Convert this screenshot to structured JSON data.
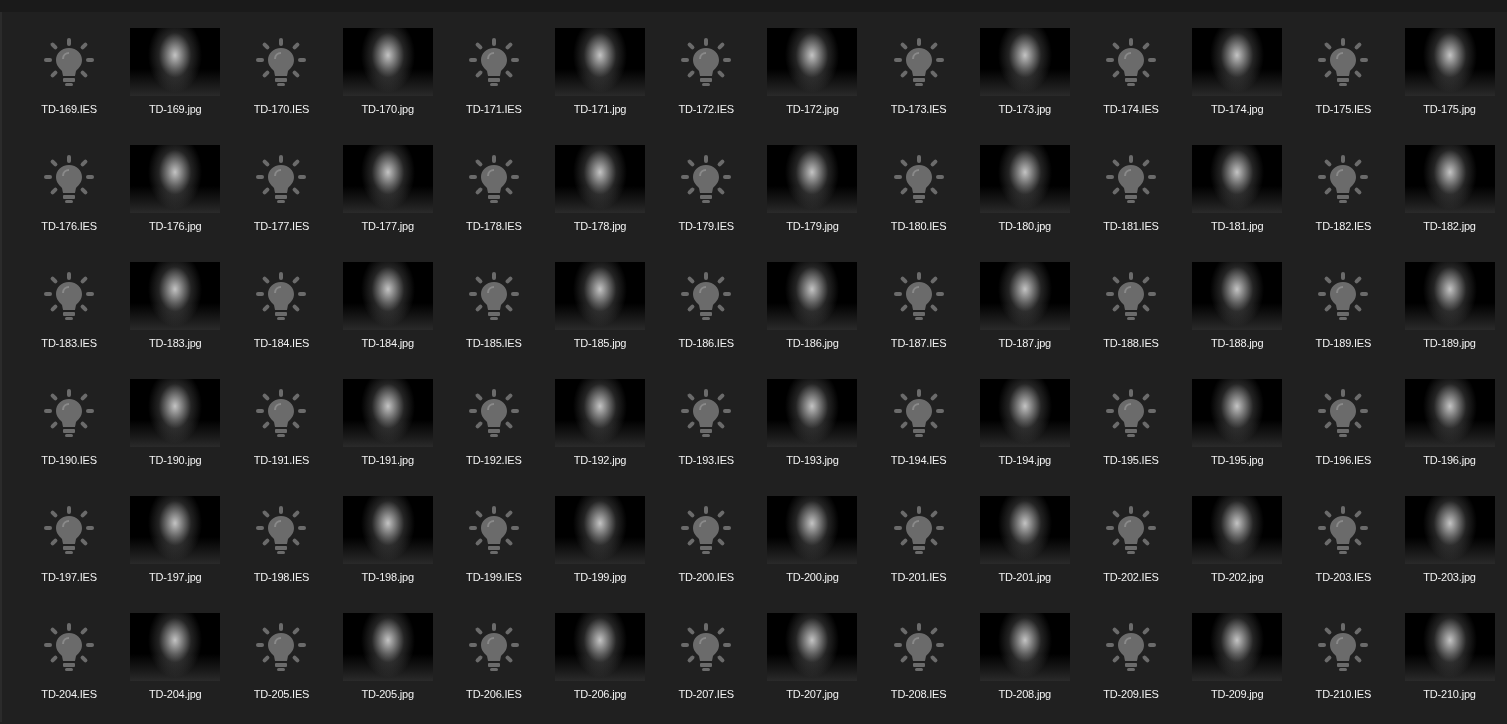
{
  "files": [
    {
      "name": "TD-169.IES",
      "kind": "ies"
    },
    {
      "name": "TD-169.jpg",
      "kind": "image"
    },
    {
      "name": "TD-170.IES",
      "kind": "ies"
    },
    {
      "name": "TD-170.jpg",
      "kind": "image"
    },
    {
      "name": "TD-171.IES",
      "kind": "ies"
    },
    {
      "name": "TD-171.jpg",
      "kind": "image"
    },
    {
      "name": "TD-172.IES",
      "kind": "ies"
    },
    {
      "name": "TD-172.jpg",
      "kind": "image"
    },
    {
      "name": "TD-173.IES",
      "kind": "ies"
    },
    {
      "name": "TD-173.jpg",
      "kind": "image"
    },
    {
      "name": "TD-174.IES",
      "kind": "ies"
    },
    {
      "name": "TD-174.jpg",
      "kind": "image"
    },
    {
      "name": "TD-175.IES",
      "kind": "ies"
    },
    {
      "name": "TD-175.jpg",
      "kind": "image"
    },
    {
      "name": "TD-176.IES",
      "kind": "ies"
    },
    {
      "name": "TD-176.jpg",
      "kind": "image"
    },
    {
      "name": "TD-177.IES",
      "kind": "ies"
    },
    {
      "name": "TD-177.jpg",
      "kind": "image"
    },
    {
      "name": "TD-178.IES",
      "kind": "ies"
    },
    {
      "name": "TD-178.jpg",
      "kind": "image"
    },
    {
      "name": "TD-179.IES",
      "kind": "ies"
    },
    {
      "name": "TD-179.jpg",
      "kind": "image"
    },
    {
      "name": "TD-180.IES",
      "kind": "ies"
    },
    {
      "name": "TD-180.jpg",
      "kind": "image"
    },
    {
      "name": "TD-181.IES",
      "kind": "ies"
    },
    {
      "name": "TD-181.jpg",
      "kind": "image"
    },
    {
      "name": "TD-182.IES",
      "kind": "ies"
    },
    {
      "name": "TD-182.jpg",
      "kind": "image"
    },
    {
      "name": "TD-183.IES",
      "kind": "ies"
    },
    {
      "name": "TD-183.jpg",
      "kind": "image"
    },
    {
      "name": "TD-184.IES",
      "kind": "ies"
    },
    {
      "name": "TD-184.jpg",
      "kind": "image"
    },
    {
      "name": "TD-185.IES",
      "kind": "ies"
    },
    {
      "name": "TD-185.jpg",
      "kind": "image"
    },
    {
      "name": "TD-186.IES",
      "kind": "ies"
    },
    {
      "name": "TD-186.jpg",
      "kind": "image"
    },
    {
      "name": "TD-187.IES",
      "kind": "ies"
    },
    {
      "name": "TD-187.jpg",
      "kind": "image"
    },
    {
      "name": "TD-188.IES",
      "kind": "ies"
    },
    {
      "name": "TD-188.jpg",
      "kind": "image"
    },
    {
      "name": "TD-189.IES",
      "kind": "ies"
    },
    {
      "name": "TD-189.jpg",
      "kind": "image"
    },
    {
      "name": "TD-190.IES",
      "kind": "ies"
    },
    {
      "name": "TD-190.jpg",
      "kind": "image"
    },
    {
      "name": "TD-191.IES",
      "kind": "ies"
    },
    {
      "name": "TD-191.jpg",
      "kind": "image"
    },
    {
      "name": "TD-192.IES",
      "kind": "ies"
    },
    {
      "name": "TD-192.jpg",
      "kind": "image"
    },
    {
      "name": "TD-193.IES",
      "kind": "ies"
    },
    {
      "name": "TD-193.jpg",
      "kind": "image"
    },
    {
      "name": "TD-194.IES",
      "kind": "ies"
    },
    {
      "name": "TD-194.jpg",
      "kind": "image"
    },
    {
      "name": "TD-195.IES",
      "kind": "ies"
    },
    {
      "name": "TD-195.jpg",
      "kind": "image"
    },
    {
      "name": "TD-196.IES",
      "kind": "ies"
    },
    {
      "name": "TD-196.jpg",
      "kind": "image"
    },
    {
      "name": "TD-197.IES",
      "kind": "ies"
    },
    {
      "name": "TD-197.jpg",
      "kind": "image"
    },
    {
      "name": "TD-198.IES",
      "kind": "ies"
    },
    {
      "name": "TD-198.jpg",
      "kind": "image"
    },
    {
      "name": "TD-199.IES",
      "kind": "ies"
    },
    {
      "name": "TD-199.jpg",
      "kind": "image"
    },
    {
      "name": "TD-200.IES",
      "kind": "ies"
    },
    {
      "name": "TD-200.jpg",
      "kind": "image"
    },
    {
      "name": "TD-201.IES",
      "kind": "ies"
    },
    {
      "name": "TD-201.jpg",
      "kind": "image"
    },
    {
      "name": "TD-202.IES",
      "kind": "ies"
    },
    {
      "name": "TD-202.jpg",
      "kind": "image"
    },
    {
      "name": "TD-203.IES",
      "kind": "ies"
    },
    {
      "name": "TD-203.jpg",
      "kind": "image"
    },
    {
      "name": "TD-204.IES",
      "kind": "ies"
    },
    {
      "name": "TD-204.jpg",
      "kind": "image"
    },
    {
      "name": "TD-205.IES",
      "kind": "ies"
    },
    {
      "name": "TD-205.jpg",
      "kind": "image"
    },
    {
      "name": "TD-206.IES",
      "kind": "ies"
    },
    {
      "name": "TD-206.jpg",
      "kind": "image"
    },
    {
      "name": "TD-207.IES",
      "kind": "ies"
    },
    {
      "name": "TD-207.jpg",
      "kind": "image"
    },
    {
      "name": "TD-208.IES",
      "kind": "ies"
    },
    {
      "name": "TD-208.jpg",
      "kind": "image"
    },
    {
      "name": "TD-209.IES",
      "kind": "ies"
    },
    {
      "name": "TD-209.jpg",
      "kind": "image"
    },
    {
      "name": "TD-210.IES",
      "kind": "ies"
    },
    {
      "name": "TD-210.jpg",
      "kind": "image"
    }
  ]
}
